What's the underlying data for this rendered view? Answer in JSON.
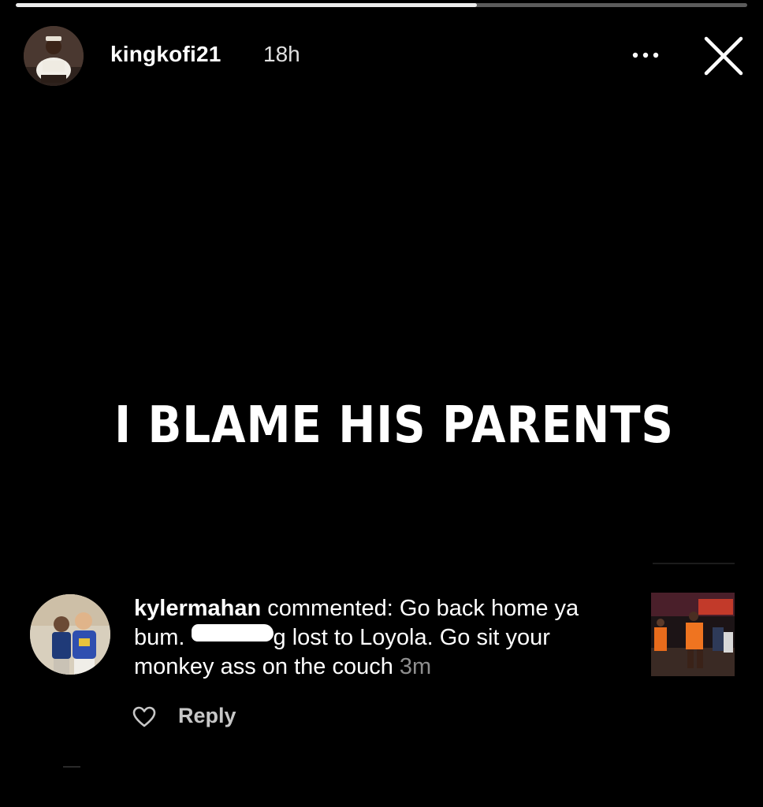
{
  "story": {
    "progress_fraction": 0.63,
    "author": {
      "username": "kingkofi21",
      "time": "18h"
    },
    "text": "I BLAME HIS PARENTS"
  },
  "header": {
    "more_icon": "more-horizontal-icon",
    "close_icon": "close-icon"
  },
  "comment": {
    "username": "kylermahan",
    "verb": " commented: ",
    "text_part1": "Go back home ya bum. ",
    "text_part2": "g lost to Loyola. Go sit your monkey ass on the couch ",
    "time": "3m",
    "reply_label": "Reply",
    "like_icon": "heart-outline-icon"
  },
  "colors": {
    "background": "#000000",
    "text": "#ffffff",
    "muted": "#8e8e8e",
    "progress_track": "#5b5b5b",
    "progress_fill": "#ececec"
  }
}
